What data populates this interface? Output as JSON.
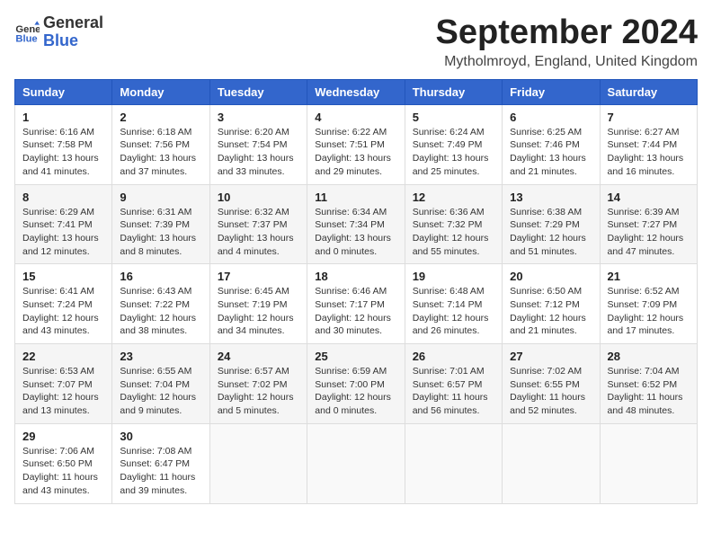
{
  "header": {
    "logo_line1": "General",
    "logo_line2": "Blue",
    "month_title": "September 2024",
    "location": "Mytholmroyd, England, United Kingdom"
  },
  "weekdays": [
    "Sunday",
    "Monday",
    "Tuesday",
    "Wednesday",
    "Thursday",
    "Friday",
    "Saturday"
  ],
  "weeks": [
    [
      {
        "day": "1",
        "info": "Sunrise: 6:16 AM\nSunset: 7:58 PM\nDaylight: 13 hours\nand 41 minutes."
      },
      {
        "day": "2",
        "info": "Sunrise: 6:18 AM\nSunset: 7:56 PM\nDaylight: 13 hours\nand 37 minutes."
      },
      {
        "day": "3",
        "info": "Sunrise: 6:20 AM\nSunset: 7:54 PM\nDaylight: 13 hours\nand 33 minutes."
      },
      {
        "day": "4",
        "info": "Sunrise: 6:22 AM\nSunset: 7:51 PM\nDaylight: 13 hours\nand 29 minutes."
      },
      {
        "day": "5",
        "info": "Sunrise: 6:24 AM\nSunset: 7:49 PM\nDaylight: 13 hours\nand 25 minutes."
      },
      {
        "day": "6",
        "info": "Sunrise: 6:25 AM\nSunset: 7:46 PM\nDaylight: 13 hours\nand 21 minutes."
      },
      {
        "day": "7",
        "info": "Sunrise: 6:27 AM\nSunset: 7:44 PM\nDaylight: 13 hours\nand 16 minutes."
      }
    ],
    [
      {
        "day": "8",
        "info": "Sunrise: 6:29 AM\nSunset: 7:41 PM\nDaylight: 13 hours\nand 12 minutes."
      },
      {
        "day": "9",
        "info": "Sunrise: 6:31 AM\nSunset: 7:39 PM\nDaylight: 13 hours\nand 8 minutes."
      },
      {
        "day": "10",
        "info": "Sunrise: 6:32 AM\nSunset: 7:37 PM\nDaylight: 13 hours\nand 4 minutes."
      },
      {
        "day": "11",
        "info": "Sunrise: 6:34 AM\nSunset: 7:34 PM\nDaylight: 13 hours\nand 0 minutes."
      },
      {
        "day": "12",
        "info": "Sunrise: 6:36 AM\nSunset: 7:32 PM\nDaylight: 12 hours\nand 55 minutes."
      },
      {
        "day": "13",
        "info": "Sunrise: 6:38 AM\nSunset: 7:29 PM\nDaylight: 12 hours\nand 51 minutes."
      },
      {
        "day": "14",
        "info": "Sunrise: 6:39 AM\nSunset: 7:27 PM\nDaylight: 12 hours\nand 47 minutes."
      }
    ],
    [
      {
        "day": "15",
        "info": "Sunrise: 6:41 AM\nSunset: 7:24 PM\nDaylight: 12 hours\nand 43 minutes."
      },
      {
        "day": "16",
        "info": "Sunrise: 6:43 AM\nSunset: 7:22 PM\nDaylight: 12 hours\nand 38 minutes."
      },
      {
        "day": "17",
        "info": "Sunrise: 6:45 AM\nSunset: 7:19 PM\nDaylight: 12 hours\nand 34 minutes."
      },
      {
        "day": "18",
        "info": "Sunrise: 6:46 AM\nSunset: 7:17 PM\nDaylight: 12 hours\nand 30 minutes."
      },
      {
        "day": "19",
        "info": "Sunrise: 6:48 AM\nSunset: 7:14 PM\nDaylight: 12 hours\nand 26 minutes."
      },
      {
        "day": "20",
        "info": "Sunrise: 6:50 AM\nSunset: 7:12 PM\nDaylight: 12 hours\nand 21 minutes."
      },
      {
        "day": "21",
        "info": "Sunrise: 6:52 AM\nSunset: 7:09 PM\nDaylight: 12 hours\nand 17 minutes."
      }
    ],
    [
      {
        "day": "22",
        "info": "Sunrise: 6:53 AM\nSunset: 7:07 PM\nDaylight: 12 hours\nand 13 minutes."
      },
      {
        "day": "23",
        "info": "Sunrise: 6:55 AM\nSunset: 7:04 PM\nDaylight: 12 hours\nand 9 minutes."
      },
      {
        "day": "24",
        "info": "Sunrise: 6:57 AM\nSunset: 7:02 PM\nDaylight: 12 hours\nand 5 minutes."
      },
      {
        "day": "25",
        "info": "Sunrise: 6:59 AM\nSunset: 7:00 PM\nDaylight: 12 hours\nand 0 minutes."
      },
      {
        "day": "26",
        "info": "Sunrise: 7:01 AM\nSunset: 6:57 PM\nDaylight: 11 hours\nand 56 minutes."
      },
      {
        "day": "27",
        "info": "Sunrise: 7:02 AM\nSunset: 6:55 PM\nDaylight: 11 hours\nand 52 minutes."
      },
      {
        "day": "28",
        "info": "Sunrise: 7:04 AM\nSunset: 6:52 PM\nDaylight: 11 hours\nand 48 minutes."
      }
    ],
    [
      {
        "day": "29",
        "info": "Sunrise: 7:06 AM\nSunset: 6:50 PM\nDaylight: 11 hours\nand 43 minutes."
      },
      {
        "day": "30",
        "info": "Sunrise: 7:08 AM\nSunset: 6:47 PM\nDaylight: 11 hours\nand 39 minutes."
      },
      {
        "day": "",
        "info": ""
      },
      {
        "day": "",
        "info": ""
      },
      {
        "day": "",
        "info": ""
      },
      {
        "day": "",
        "info": ""
      },
      {
        "day": "",
        "info": ""
      }
    ]
  ]
}
